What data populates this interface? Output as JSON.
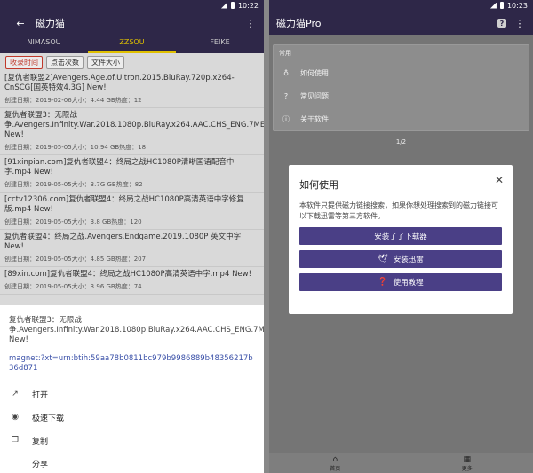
{
  "left": {
    "status": {
      "time": "10:22"
    },
    "appbar": {
      "title": "磁力猫"
    },
    "tabs": [
      "NIMASOU",
      "ZZSOU",
      "FEIKE"
    ],
    "sort_chips": [
      "收录时间",
      "点击次数",
      "文件大小"
    ],
    "results": [
      {
        "title": "[复仇者联盟2]Avengers.Age.of.Ultron.2015.BluRay.720p.x264-CnSCG[国英特效4.3G] New!",
        "meta": "创建日期：2019-02-06大小：4.44 GB热度：12"
      },
      {
        "title": "复仇者联盟3：无限战争.Avengers.Infinity.War.2018.1080p.BluRay.x264.AAC.CHS_ENG.7MEIJU.COM.mp4 New!",
        "meta": "创建日期：2019-05-05大小：10.94 GB热度：18"
      },
      {
        "title": "[91xinpian.com]复仇者联盟4：终局之战HC1080P清晰国语配音中字.mp4 New!",
        "meta": "创建日期：2019-05-05大小：3.7G GB热度：82"
      },
      {
        "title": "[cctv12306.com]复仇者联盟4：终局之战HC1080P高清英语中字修复版.mp4 New!",
        "meta": "创建日期：2019-05-05大小：3.8 GB热度：120"
      },
      {
        "title": "复仇者联盟4：终局之战.Avengers.Endgame.2019.1080P 英文中字 New!",
        "meta": "创建日期：2019-05-05大小：4.85 GB热度：207"
      },
      {
        "title": "[89xin.com]复仇者联盟4：终局之战HC1080P高清英语中字.mp4 New!",
        "meta": "创建日期：2019-05-05大小：3.96 GB热度：74"
      }
    ],
    "sheet": {
      "title": "复仇者联盟3：无限战争.Avengers.Infinity.War.2018.1080p.BluRay.x264.AAC.CHS_ENG.7MEIJU.COM.mp4 New!",
      "magnet": "magnet:?xt=urn:btih:59aa78b0811bc979b9986889b48356217b36d871",
      "actions": [
        "打开",
        "极速下载",
        "复制",
        "分享"
      ]
    }
  },
  "right": {
    "status": {
      "time": "10:23"
    },
    "appbar": {
      "title": "磁力猫Pro"
    },
    "menu": {
      "header": "常用",
      "items": [
        "如何使用",
        "常见问题",
        "关于软件"
      ]
    },
    "pager": "1/2",
    "dialog": {
      "title": "如何使用",
      "body": "本软件只提供磁力链接搜索，如果你想处理搜索到的磁力链接可以下载迅雷等第三方软件。",
      "buttons": [
        "安装了了下载器",
        "安装迅雷",
        "使用教程"
      ]
    },
    "bottomnav": [
      "首页",
      "更多"
    ]
  }
}
